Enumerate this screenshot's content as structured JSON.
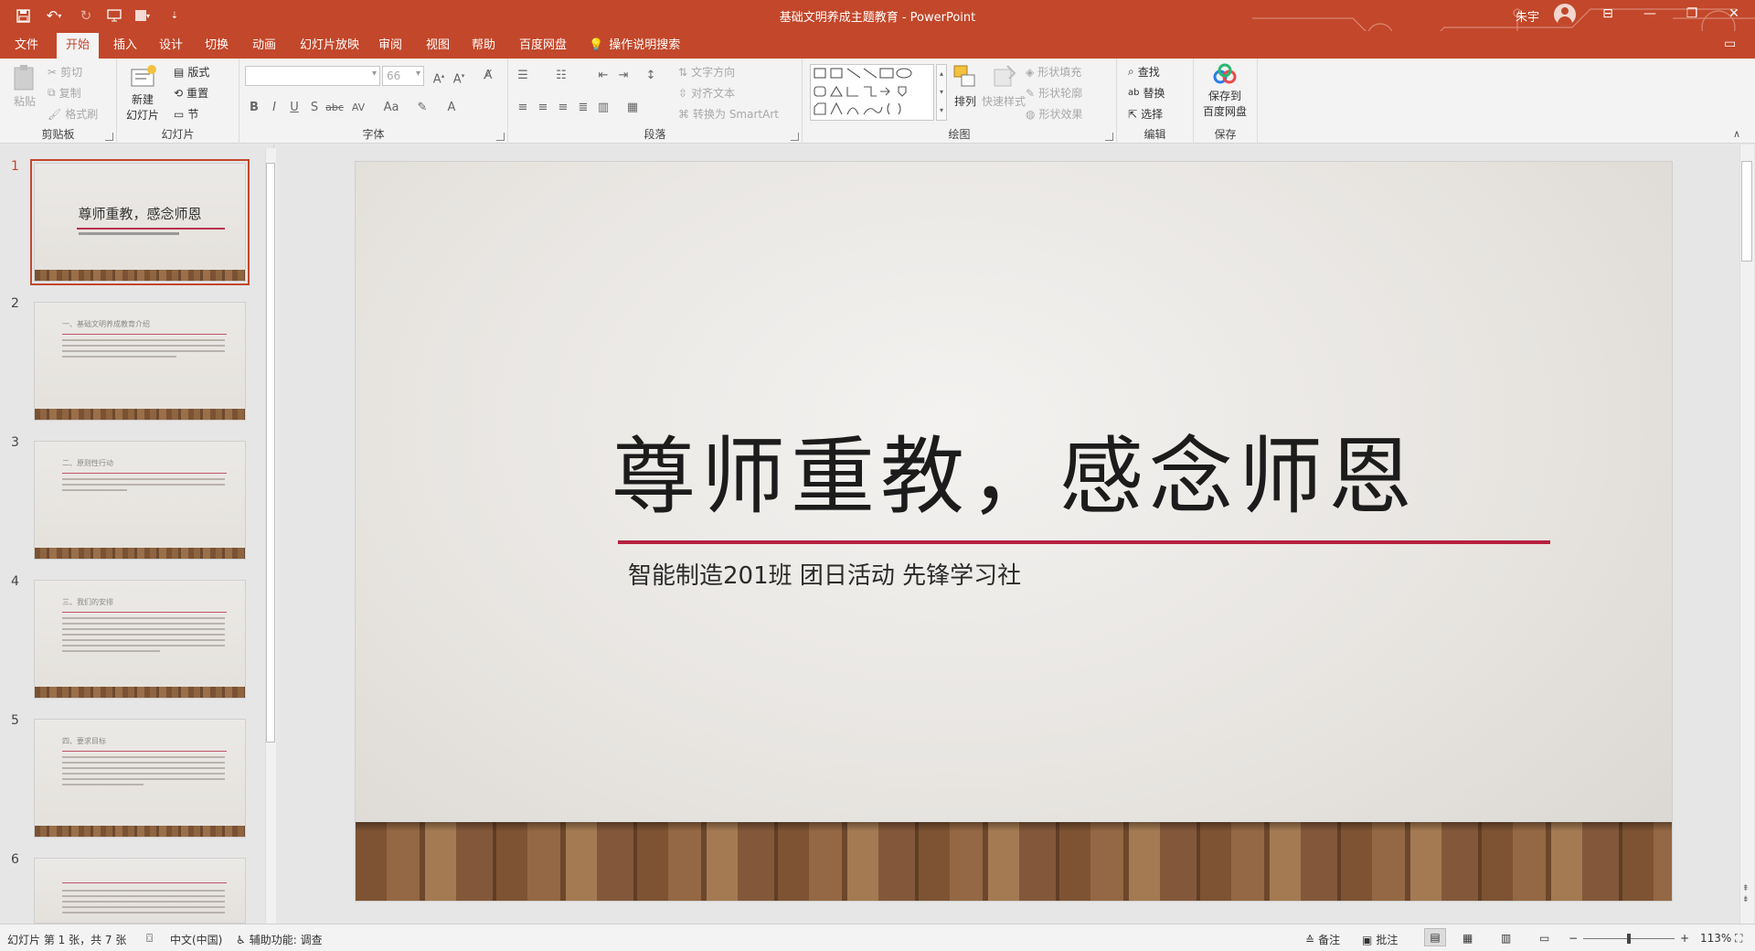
{
  "titlebar": {
    "doc_title": "基础文明养成主题教育  -  PowerPoint",
    "user": "朱宇",
    "minimize": "—",
    "restore": "❐",
    "close": "✕",
    "ribbon_display": "⊟"
  },
  "tabs": [
    {
      "label": "文件"
    },
    {
      "label": "开始"
    },
    {
      "label": "插入"
    },
    {
      "label": "设计"
    },
    {
      "label": "切换"
    },
    {
      "label": "动画"
    },
    {
      "label": "幻灯片放映"
    },
    {
      "label": "审阅"
    },
    {
      "label": "视图"
    },
    {
      "label": "帮助"
    },
    {
      "label": "百度网盘"
    }
  ],
  "tellme": "操作说明搜索",
  "ribbon": {
    "clipboard": {
      "label": "剪贴板",
      "paste": "粘贴",
      "cut": "剪切",
      "copy": "复制",
      "format_painter": "格式刷"
    },
    "slides": {
      "label": "幻灯片",
      "new_slide": "新建",
      "new_slide2": "幻灯片",
      "layout": "版式",
      "reset": "重置",
      "section": "节"
    },
    "font": {
      "label": "字体",
      "size": "66"
    },
    "paragraph": {
      "label": "段落",
      "text_direction": "文字方向",
      "align_text": "对齐文本",
      "smartart": "转换为 SmartArt"
    },
    "drawing": {
      "label": "绘图",
      "arrange": "排列",
      "quick_styles": "快速样式",
      "shape_fill": "形状填充",
      "shape_outline": "形状轮廓",
      "shape_effects": "形状效果"
    },
    "editing": {
      "label": "编辑",
      "find": "查找",
      "replace": "替换",
      "select": "选择"
    },
    "save": {
      "label": "保存",
      "save_to": "保存到",
      "baidu": "百度网盘"
    }
  },
  "thumbnails": [
    {
      "num": "1",
      "title": "尊师重教，感念师恩"
    },
    {
      "num": "2",
      "title": "一、基础文明养成教育介绍"
    },
    {
      "num": "3",
      "title": "二、原则性行动"
    },
    {
      "num": "4",
      "title": "三、我们的安排"
    },
    {
      "num": "5",
      "title": "四、要求目标"
    },
    {
      "num": "6",
      "title": ""
    }
  ],
  "slide": {
    "title": "尊师重教，感念师恩",
    "subtitle": "智能制造201班 团日活动 先锋学习社"
  },
  "statusbar": {
    "slide_info": "幻灯片 第 1 张，共 7 张",
    "language": "中文(中国)",
    "accessibility": "辅助功能: 调查",
    "notes": "备注",
    "comments": "批注",
    "zoom": "113%"
  },
  "colors": {
    "accent": "#c3472a",
    "slide_rule": "#b6203e"
  }
}
